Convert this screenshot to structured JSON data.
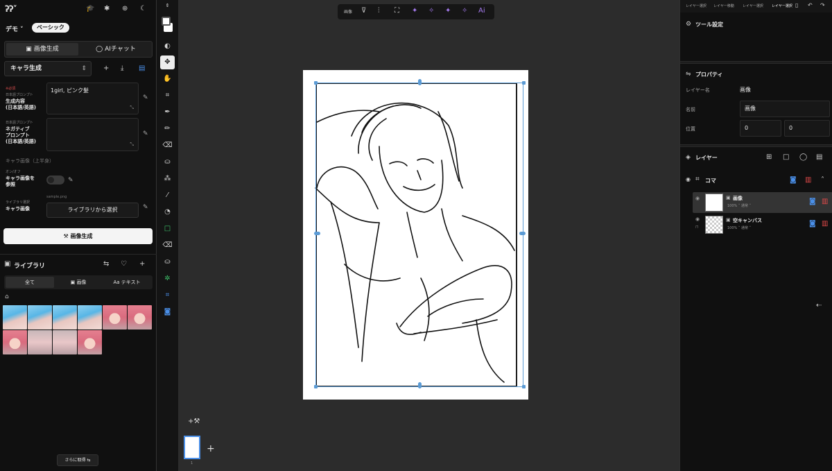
{
  "left_panel": {
    "topbar_icons": [
      "graduation-cap-icon",
      "bug-icon",
      "zoom-icon",
      "moon-icon"
    ],
    "workspace_label": "デモ",
    "mode_badge": "ベーシック",
    "tabs": [
      "画像生成",
      "AIチャット"
    ],
    "preset_select": "キャラ生成",
    "prompt": {
      "required_tag": "※必須",
      "hint": "日本語プロンプト",
      "label_line1": "生成内容",
      "label_line2": "(日本語/英語)",
      "value": "1girl, ピンク髪"
    },
    "negative_prompt": {
      "hint": "日本語プロンプト",
      "label_line1": "ネガティブ",
      "label_line2": "プロンプト",
      "label_line3": "(日本語/英語)",
      "value": ""
    },
    "section_hint": "キャラ画像（上半身）",
    "reference_toggle": {
      "hint": "オン/オフ",
      "label_line1": "キャラ画像を",
      "label_line2": "参照"
    },
    "character_image": {
      "hint": "ライブラリ選択",
      "label": "キャラ画像",
      "filename": "sample.png",
      "button": "ライブラリから選択"
    },
    "generate_button": "画像生成",
    "library": {
      "title": "ライブラリ",
      "tabs": [
        "全て",
        "画像",
        "テキスト"
      ],
      "more_button": "さらに取得"
    }
  },
  "top_toolbar": {
    "label": "画像"
  },
  "canvas": {
    "page_number": "1"
  },
  "right_panel": {
    "tabs": [
      "レイヤー選択",
      "レイヤー移動",
      "レイヤー選択",
      "レイヤー選択"
    ],
    "tool_settings_title": "ツール設定",
    "properties": {
      "title": "プロパティ",
      "layer_name_label": "レイヤー名",
      "layer_name_value": "画像",
      "name_label": "名前",
      "name_value": "画像",
      "position_label": "位置",
      "pos_x": "0",
      "pos_y": "0"
    },
    "layers": {
      "title": "レイヤー",
      "group_name": "コマ",
      "items": [
        {
          "name": "画像",
          "opacity": "100%",
          "blend": "通常"
        },
        {
          "name": "空キャンバス",
          "opacity": "100%",
          "blend": "通常"
        }
      ]
    }
  }
}
